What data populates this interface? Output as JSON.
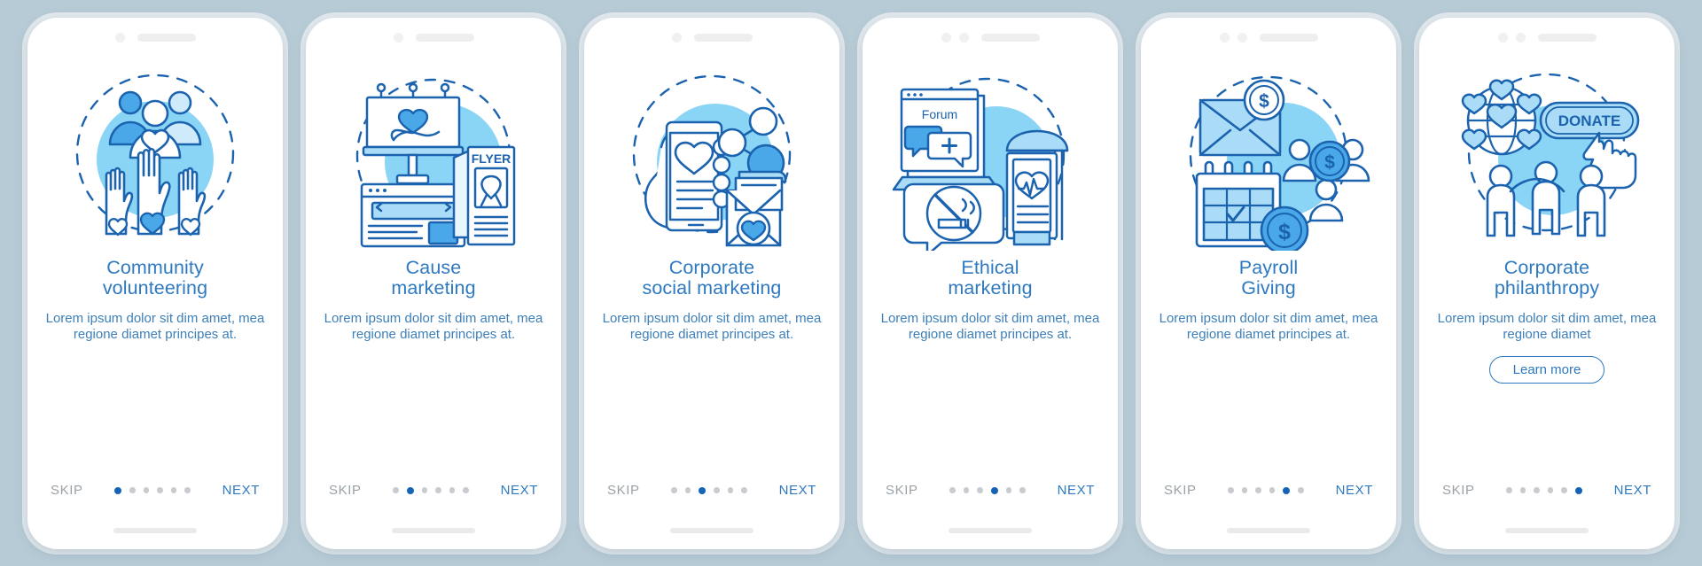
{
  "background_color": "#b7cbd6",
  "palette": {
    "title_blue": "#2e79c0",
    "body_blue": "#3d7fb8",
    "skip_gray": "#9aa2a8",
    "dot_inactive": "#c8ccd0",
    "dot_active": "#1463b5",
    "stroke_dark": "#1b63ae",
    "fill_mid": "#4aa8e8",
    "fill_light": "#aadcf7",
    "blob": "#8ad4f5"
  },
  "common": {
    "skip_label": "SKIP",
    "next_label": "NEXT",
    "total_dots": 6,
    "body_text": "Lorem ipsum dolor sit dim amet, mea regione diamet principes at."
  },
  "screens": [
    {
      "id": "community-volunteering",
      "title": "Community\nvolunteering",
      "description": "Lorem ipsum dolor sit dim amet, mea regione diamet principes at.",
      "skip_label": "SKIP",
      "next_label": "NEXT",
      "active_dot": 1,
      "notch_dots": 1,
      "illustration": "raised-hands-with-hearts-and-people-group",
      "has_learn_more": false,
      "learn_more_label": ""
    },
    {
      "id": "cause-marketing",
      "title": "Cause\nmarketing",
      "description": "Lorem ipsum dolor sit dim amet, mea regione diamet principes at.",
      "skip_label": "SKIP",
      "next_label": "NEXT",
      "active_dot": 2,
      "notch_dots": 1,
      "illustration": "billboard-browser-window-and-flyer-with-ribbon",
      "flyer_label": "FLYER",
      "has_learn_more": false,
      "learn_more_label": ""
    },
    {
      "id": "corporate-social-marketing",
      "title": "Corporate\nsocial marketing",
      "description": "Lorem ipsum dolor sit dim amet, mea regione diamet principes at.",
      "skip_label": "SKIP",
      "next_label": "NEXT",
      "active_dot": 3,
      "notch_dots": 1,
      "illustration": "hand-holding-phone-share-nodes-and-envelope-with-heart",
      "has_learn_more": false,
      "learn_more_label": ""
    },
    {
      "id": "ethical-marketing",
      "title": "Ethical\nmarketing",
      "description": "Lorem ipsum dolor sit dim amet, mea regione diamet principes at.",
      "skip_label": "SKIP",
      "next_label": "NEXT",
      "active_dot": 4,
      "notch_dots": 2,
      "illustration": "laptop-forum-no-smoking-sign-and-bus-stop-health-ad",
      "laptop_label": "Forum",
      "has_learn_more": false,
      "learn_more_label": ""
    },
    {
      "id": "payroll-giving",
      "title": "Payroll\nGiving",
      "description": "Lorem ipsum dolor sit dim amet, mea regione diamet principes at.",
      "skip_label": "SKIP",
      "next_label": "NEXT",
      "active_dot": 5,
      "notch_dots": 2,
      "illustration": "envelope-with-dollar-calendar-with-check-and-people-with-coin",
      "has_learn_more": false,
      "learn_more_label": ""
    },
    {
      "id": "corporate-philanthropy",
      "title": "Corporate\nphilanthropy",
      "description": "Lorem ipsum dolor sit dim amet, mea regione diamet",
      "skip_label": "SKIP",
      "next_label": "NEXT",
      "active_dot": 6,
      "notch_dots": 2,
      "illustration": "globe-of-hearts-donate-button-and-three-people",
      "donate_label": "DONATE",
      "has_learn_more": true,
      "learn_more_label": "Learn more"
    }
  ]
}
